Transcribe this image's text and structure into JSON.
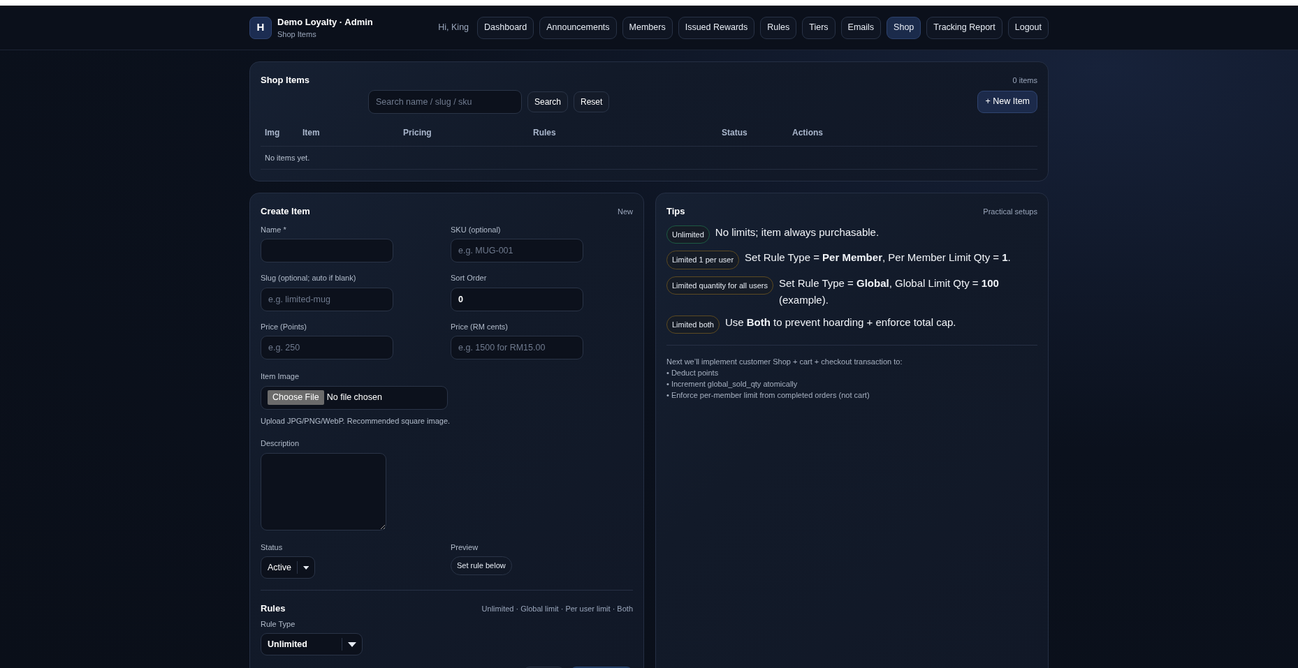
{
  "brand": {
    "logo_letter": "H",
    "title": "Demo Loyalty · Admin",
    "subtitle": "Shop Items"
  },
  "greeting": "Hi, King",
  "nav": [
    {
      "label": "Dashboard",
      "selected": false
    },
    {
      "label": "Announcements",
      "selected": false
    },
    {
      "label": "Members",
      "selected": false
    },
    {
      "label": "Issued Rewards",
      "selected": false
    },
    {
      "label": "Rules",
      "selected": false
    },
    {
      "label": "Tiers",
      "selected": false
    },
    {
      "label": "Emails",
      "selected": false
    },
    {
      "label": "Shop",
      "selected": true
    },
    {
      "label": "Tracking Report",
      "selected": false
    },
    {
      "label": "Logout",
      "selected": false
    }
  ],
  "shop_items": {
    "title": "Shop Items",
    "count": "0 items",
    "search": {
      "placeholder": "Search name / slug / sku"
    },
    "search_button": "Search",
    "reset_button": "Reset",
    "new_button": "+ New Item",
    "table": {
      "columns": [
        "Img",
        "Item",
        "Pricing",
        "Rules",
        "Status",
        "Actions"
      ],
      "empty_text": "No items yet."
    }
  },
  "create_item": {
    "title": "Create Item",
    "tag": "New",
    "fields": [
      {
        "kind": "text",
        "label": "Name *"
      },
      {
        "kind": "text",
        "label": "SKU (optional)",
        "placeholder": "e.g. MUG-001"
      },
      {
        "kind": "text",
        "label": "Slug (optional; auto if blank)",
        "placeholder": "e.g. limited-mug"
      },
      {
        "kind": "text",
        "label": "Sort Order",
        "value": "0"
      },
      {
        "kind": "text",
        "label": "Price (Points)",
        "placeholder": "e.g. 250"
      },
      {
        "kind": "text",
        "label": "Price (RM cents)",
        "placeholder": "e.g. 1500 for RM15.00"
      }
    ],
    "image": {
      "label": "Item Image",
      "button": "Choose File",
      "file_status": "No file chosen",
      "help": "Upload JPG/PNG/WebP. Recommended square image."
    },
    "description": {
      "label": "Description"
    },
    "status": {
      "label": "Status",
      "value": "Active"
    },
    "preview": {
      "label": "Preview",
      "value": "Set rule below"
    },
    "rules": {
      "title": "Rules",
      "hint": "Unlimited · Global limit · Per user limit · Both",
      "rule_type": {
        "label": "Rule Type",
        "value": "Unlimited"
      }
    }
  },
  "tips": {
    "title": "Tips",
    "subtitle": "Practical setups",
    "items": [
      {
        "badge": "Unlimited",
        "color": "#1d5a43",
        "text": "No limits; item always purchasable."
      },
      {
        "badge": "Limited 1 per user",
        "color": "#5c4a22",
        "text": "Set Rule Type = **Per Member**, Per Member Limit Qty = **1**."
      },
      {
        "badge": "Limited quantity for all users",
        "color": "#5c4a22",
        "text": "Set Rule Type = **Global**, Global Limit Qty = **100** (example)."
      },
      {
        "badge": "Limited both",
        "color": "#5c4a22",
        "text": "Use **Both** to prevent hoarding + enforce total cap."
      }
    ],
    "notes": [
      "Next we’ll implement customer Shop + cart + checkout transaction to:",
      "• Deduct points",
      "• Increment global_sold_qty atomically",
      "• Enforce per-member limit from completed orders (not cart)"
    ]
  }
}
